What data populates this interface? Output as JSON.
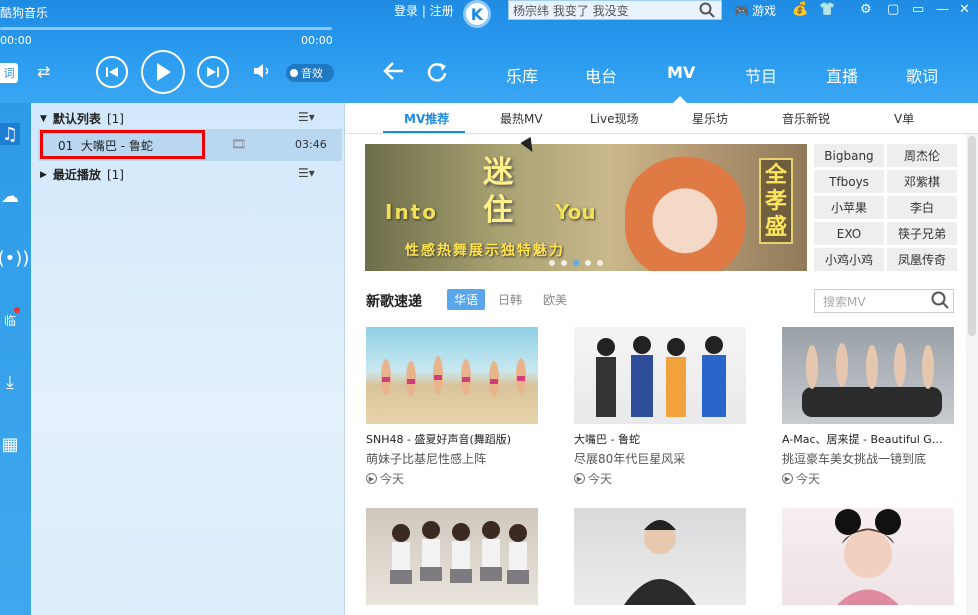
{
  "app": {
    "title": "酷狗音乐"
  },
  "player": {
    "time_elapsed": "00:00",
    "time_total": "00:00",
    "lyrics_tag": "词",
    "sound_effect": "音效"
  },
  "account": {
    "login": "登录",
    "separator": "|",
    "register": "注册",
    "search_text": "杨宗纬 我变了 我没变",
    "game": "游戏"
  },
  "nav": {
    "tabs": [
      "乐库",
      "电台",
      "MV",
      "节目",
      "直播",
      "歌词"
    ],
    "active": "MV"
  },
  "playlist": {
    "default_list": {
      "name": "默认列表",
      "count": "[1]"
    },
    "song": {
      "index": "01",
      "title": "大嘴巴 - 鲁蛇",
      "duration": "03:46"
    },
    "recent": {
      "name": "最近播放",
      "count": "[1]"
    }
  },
  "mv": {
    "subtabs": [
      "MV推荐",
      "最热MV",
      "Live现场",
      "星乐坊",
      "音乐新锐",
      "V单"
    ],
    "banner": {
      "into": "Into",
      "you": "You",
      "big1": "迷",
      "big2": "住",
      "sub": "性感热舞展示独特魅力",
      "artist": "全孝盛"
    },
    "artist_tags": [
      "Bigbang",
      "周杰伦",
      "Tfboys",
      "邓紫棋",
      "小苹果",
      "李白",
      "EXO",
      "筷子兄弟",
      "小鸡小鸡",
      "凤凰传奇"
    ],
    "section_title": "新歌速递",
    "languages": [
      "华语",
      "日韩",
      "欧美"
    ],
    "search_placeholder": "搜索MV",
    "cards": [
      {
        "title": "SNH48 - 盛夏好声音(舞蹈版)",
        "desc": "萌妹子比基尼性感上阵",
        "date": "今天"
      },
      {
        "title": "大嘴巴 - 鲁蛇",
        "desc": "尽展80年代巨星风采",
        "date": "今天"
      },
      {
        "title": "A-Mac、居来提 - Beautiful G…",
        "desc": "挑逗豪车美女挑战一镜到底",
        "date": "今天"
      }
    ]
  },
  "colors": {
    "accent": "#1e8ae3",
    "highlight": "#e00000"
  }
}
